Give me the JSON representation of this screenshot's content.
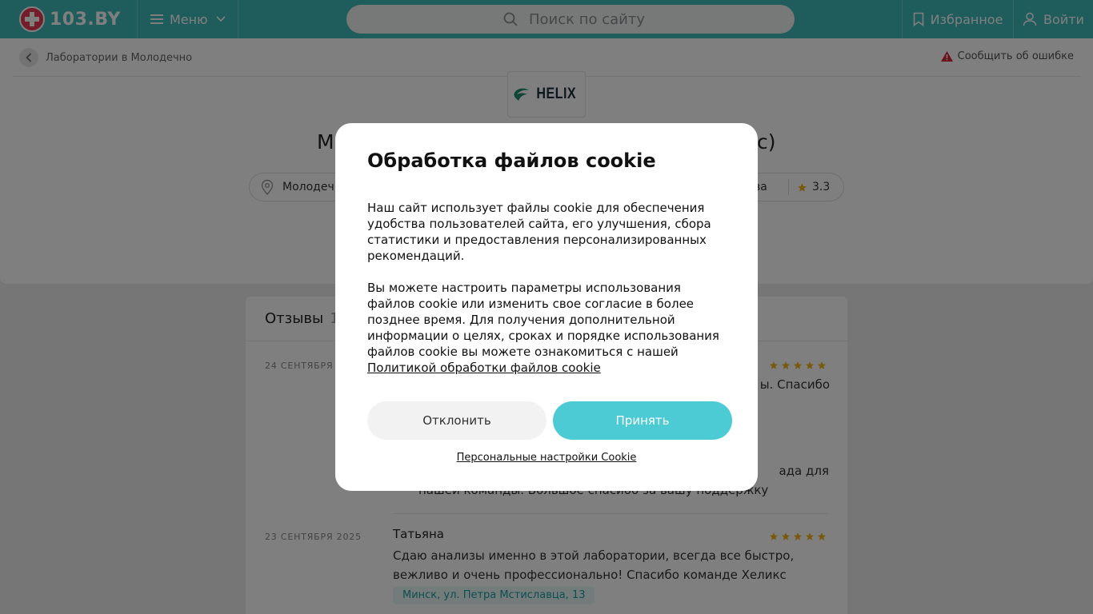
{
  "header": {
    "logo_text": "103.BY",
    "menu_label": "Меню",
    "search_placeholder": "Поиск по сайту",
    "favorites_label": "Избранное",
    "login_label": "Войти",
    "accent_color": "#3fb8b9"
  },
  "page": {
    "breadcrumb": "Лаборатории в Молодечно",
    "report_error": "Сообщить об ошибке",
    "logo_text": "HELIX",
    "title_left_fragment": "М",
    "title_right_fragment": "с)",
    "location_fragment": "Молодеч",
    "reviews_fragment": "ыва",
    "rating": "3.3"
  },
  "reviews": {
    "heading": "Отзывы",
    "count_fragment": "1",
    "items": [
      {
        "date": "24 СЕНТЯБРЯ",
        "text_fragment": "ы. Спасибо",
        "reply_fragment_1": "ада для",
        "reply_fragment_2": "нашей команды. Большое спасибо за вашу поддержку",
        "stars": 5
      },
      {
        "date": "23 СЕНТЯБРЯ 2025",
        "author": "Татьяна",
        "text_line_1": "Сдаю анализы именно в этой лаборатории, всегда все быстро,",
        "text_line_2": "вежливо и очень профессионально! Спасибо команде Хеликс",
        "address": "Минск, ул. Петра Мстиславца, 13",
        "stars": 5
      }
    ]
  },
  "cookie_modal": {
    "title": "Обработка файлов cookie",
    "paragraph_1": "Наш сайт использует файлы cookie для обеспечения удобства пользователей сайта, его улучшения, сбора статистики и предоставления персонализированных рекомендаций.",
    "paragraph_2": "Вы можете настроить параметры использования файлов cookie или изменить свое согласие в более позднее время. Для получения дополнительной информации о целях, сроках и порядке использования файлов cookie вы можете ознакомиться с нашей",
    "policy_link": "Политикой обработки файлов cookie",
    "decline_label": "Отклонить",
    "accept_label": "Принять",
    "personal_settings_link": "Персональные настройки Cookie",
    "accept_color": "#4ccbd5"
  }
}
